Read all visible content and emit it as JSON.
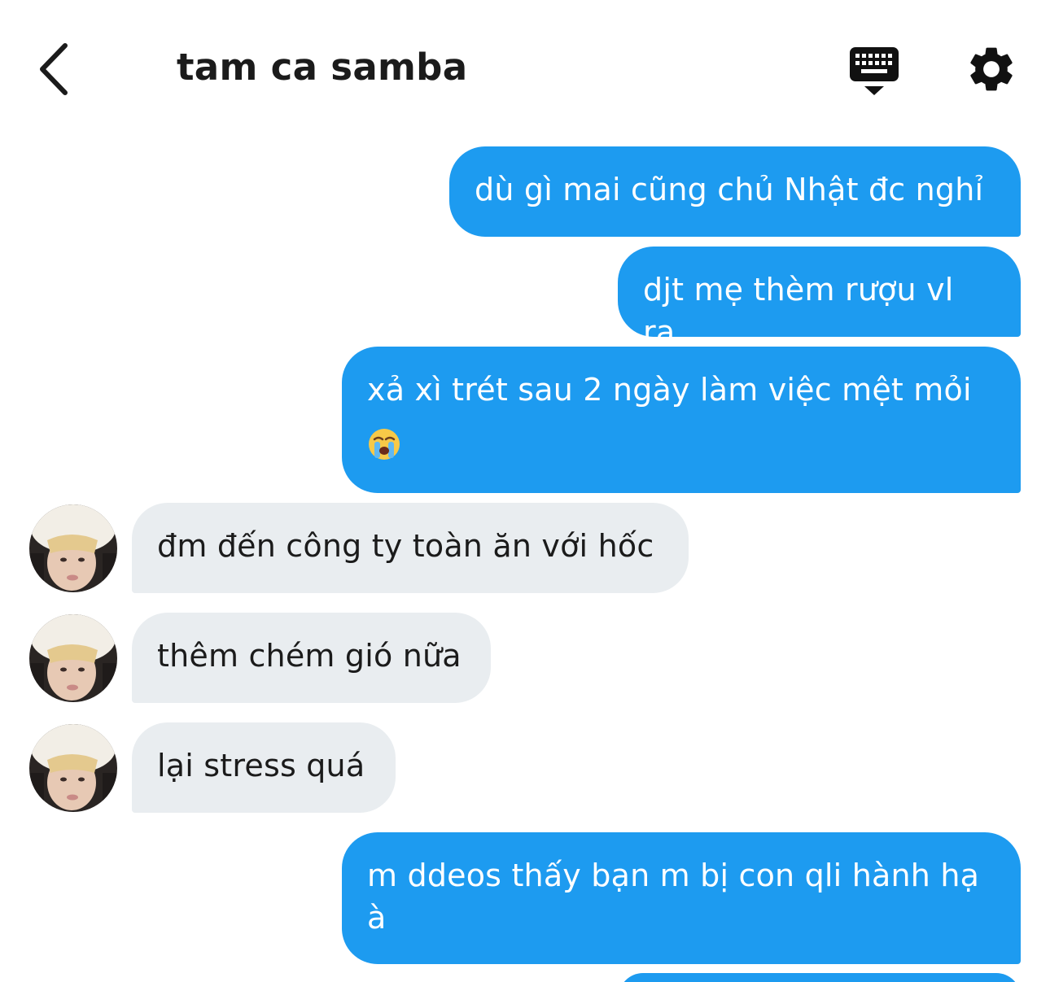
{
  "header": {
    "title": "tam ca samba"
  },
  "messages": {
    "m1": "dù gì mai cũng chủ Nhật đc nghỉ",
    "m2": "djt mẹ thèm rượu vl ra",
    "m3_line1": "xả xì trét sau 2 ngày làm việc mệt mỏi",
    "m4": "đm đến công ty toàn ăn với hốc",
    "m5": "thêm chém gió nữa",
    "m6": "lại stress quá",
    "m7_line1": "m ddeos thấy bạn m bị con qli hành hạ",
    "m7_line2": "à"
  },
  "icons": {
    "back": "chevron-left-icon",
    "keyboard": "keyboard-icon",
    "settings": "gear-icon",
    "emoji": "loudly-crying-face-emoji"
  },
  "colors": {
    "outgoing_bubble": "#1d9bf0",
    "incoming_bubble": "#e9edf0",
    "text_dark": "#1b1b1b"
  }
}
